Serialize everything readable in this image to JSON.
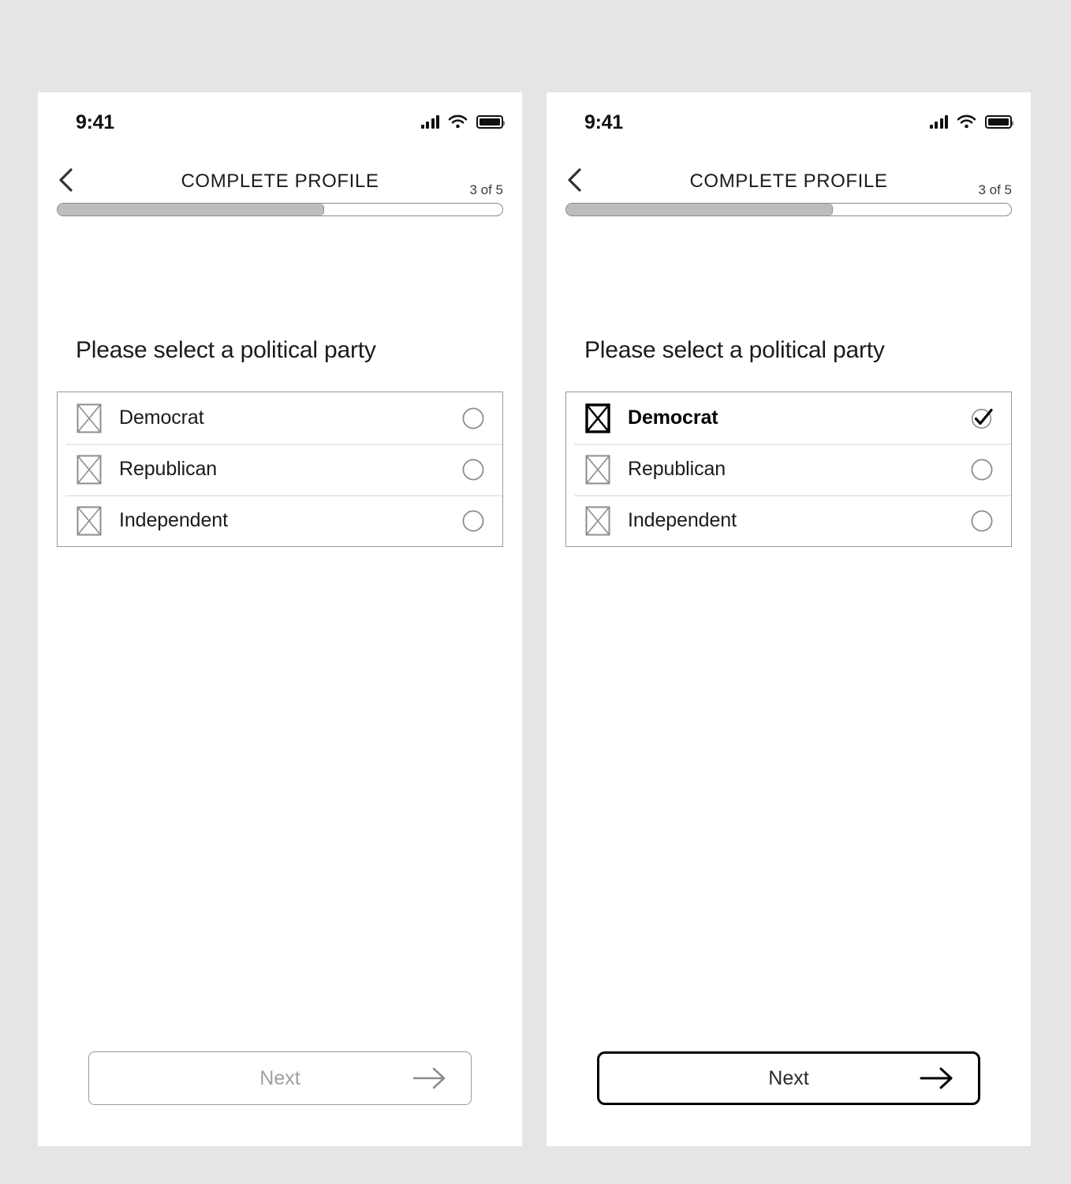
{
  "page": {
    "background_color": "#e5e5e5",
    "panel_color": "#ffffff"
  },
  "status_bar": {
    "time": "9:41",
    "cellular_icon": "cellular-bars-icon",
    "wifi_icon": "wifi-icon",
    "battery_icon": "battery-full-icon"
  },
  "nav": {
    "back_icon": "chevron-left-icon",
    "title": "COMPLETE PROFILE",
    "step_label": "3 of 5"
  },
  "progress": {
    "current_step": 3,
    "total_steps": 5,
    "percent": 60,
    "fill_color": "#bcbcbc",
    "track_color": "#ffffff",
    "border_color": "#8a8a8a"
  },
  "content": {
    "heading": "Please select a political party"
  },
  "options": [
    {
      "label": "Democrat",
      "thumb_icon": "image-placeholder-icon",
      "mark_icon": "radio-unselected-icon"
    },
    {
      "label": "Republican",
      "thumb_icon": "image-placeholder-icon",
      "mark_icon": "radio-unselected-icon"
    },
    {
      "label": "Independent",
      "thumb_icon": "image-placeholder-icon",
      "mark_icon": "radio-unselected-icon"
    }
  ],
  "options_selected": [
    {
      "label": "Democrat",
      "thumb_icon": "image-placeholder-icon",
      "mark_icon": "check-circle-icon"
    },
    {
      "label": "Republican",
      "thumb_icon": "image-placeholder-icon",
      "mark_icon": "radio-unselected-icon"
    },
    {
      "label": "Independent",
      "thumb_icon": "image-placeholder-icon",
      "mark_icon": "radio-unselected-icon"
    }
  ],
  "footer": {
    "next_label": "Next",
    "arrow_icon": "arrow-right-icon",
    "disabled_text_color": "#a0a0a0",
    "enabled_text_color": "#2b2b2b"
  },
  "screens": [
    {
      "name": "empty-state",
      "selected_option": null,
      "next_enabled": false
    },
    {
      "name": "selected-state",
      "selected_option": "Democrat",
      "next_enabled": true
    }
  ]
}
